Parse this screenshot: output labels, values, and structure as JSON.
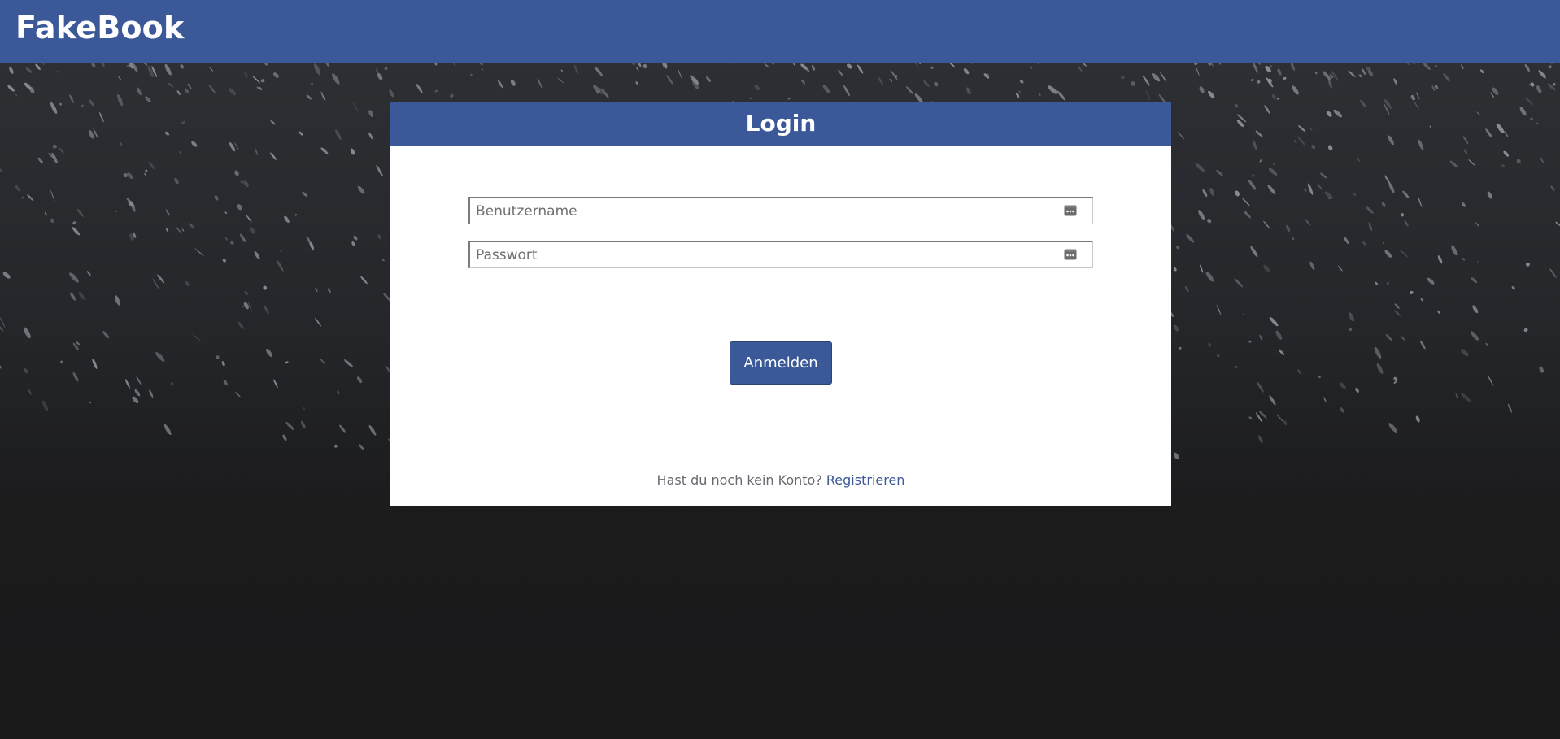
{
  "app": {
    "brand": "FakeBook",
    "colors": {
      "brand_blue": "#3b5998",
      "card_bg": "#ffffff",
      "background_dark": "#1b1b1c"
    }
  },
  "login": {
    "title": "Login",
    "username_placeholder": "Benutzername",
    "username_value": "",
    "username_icon": "password-manager-key-icon",
    "password_placeholder": "Passwort",
    "password_value": "",
    "password_icon": "password-manager-key-icon",
    "submit_label": "Anmelden",
    "register_prompt": "Hast du noch kein Konto?",
    "register_link": "Registrieren"
  }
}
